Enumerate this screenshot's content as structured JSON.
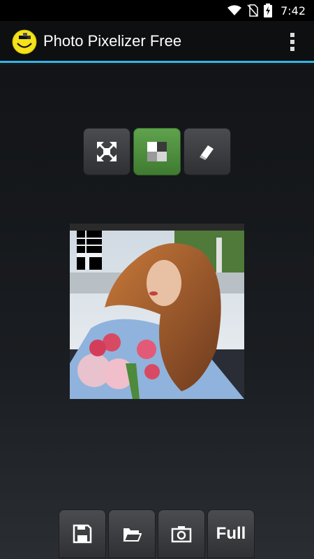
{
  "status": {
    "time": "7:42"
  },
  "app": {
    "title": "Photo Pixelizer Free"
  },
  "modes": [
    {
      "name": "fit-icon",
      "active": false
    },
    {
      "name": "pixelate-icon",
      "active": true
    },
    {
      "name": "eraser-icon",
      "active": false
    }
  ],
  "bottom": {
    "save_icon": "floppy-disk-icon",
    "open_icon": "folder-icon",
    "camera_icon": "camera-icon",
    "full_label": "Full"
  },
  "colors": {
    "accent": "#33b5e5",
    "active_button": "#4f8f3f"
  }
}
